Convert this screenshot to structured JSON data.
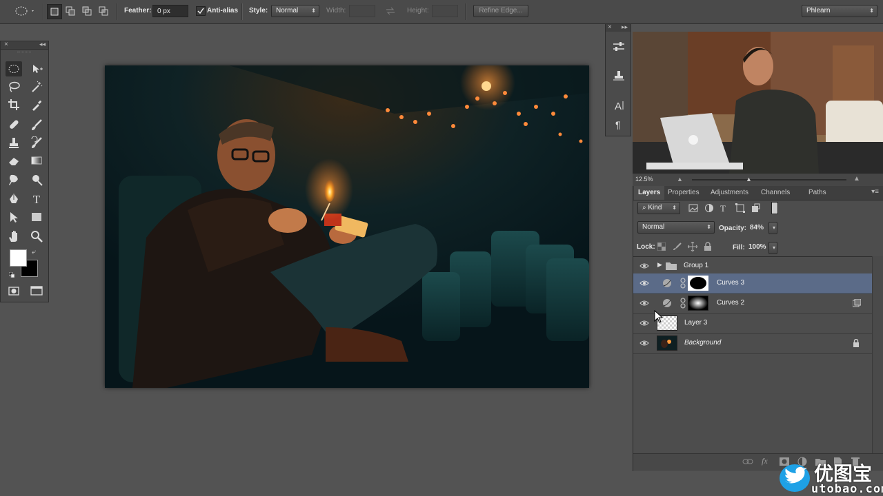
{
  "options_bar": {
    "feather_label": "Feather:",
    "feather_value": "0 px",
    "antialias_label": "Anti-alias",
    "style_label": "Style:",
    "style_value": "Normal",
    "width_label": "Width:",
    "height_label": "Height:",
    "refine_edge_label": "Refine Edge...",
    "workspace_value": "Phlearn"
  },
  "video": {
    "zoom": "12.5%"
  },
  "layers_panel": {
    "tabs": [
      {
        "label": "Layers",
        "active": true
      },
      {
        "label": "Properties",
        "active": false
      },
      {
        "label": "Adjustments",
        "active": false
      },
      {
        "label": "Channels",
        "active": false
      },
      {
        "label": "Paths",
        "active": false
      }
    ],
    "filter_label": "Kind",
    "blend_mode": "Normal",
    "opacity_label": "Opacity:",
    "opacity_value": "84%",
    "lock_label": "Lock:",
    "fill_label": "Fill:",
    "fill_value": "100%",
    "layers": [
      {
        "name": "Group 1",
        "type": "group",
        "selected": false
      },
      {
        "name": "Curves 3",
        "type": "adjustment",
        "selected": true
      },
      {
        "name": "Curves 2",
        "type": "adjustment",
        "selected": false
      },
      {
        "name": "Layer 3",
        "type": "pixel",
        "selected": false
      },
      {
        "name": "Background",
        "type": "background",
        "selected": false
      }
    ],
    "footer_icons": [
      "link-icon",
      "fx-icon",
      "mask-icon",
      "adjustment-icon",
      "folder-icon",
      "new-layer-icon",
      "trash-icon"
    ]
  },
  "tools": [
    "elliptical-marquee-icon",
    "move-icon",
    "lasso-icon",
    "magic-wand-icon",
    "crop-icon",
    "eyedropper-icon",
    "healing-brush-icon",
    "brush-icon",
    "clone-stamp-icon",
    "history-brush-icon",
    "eraser-icon",
    "gradient-icon",
    "smudge-icon",
    "dodge-icon",
    "pen-icon",
    "type-icon",
    "path-selection-icon",
    "rectangle-icon",
    "hand-icon",
    "zoom-icon"
  ],
  "colors": {
    "foreground": "#ffffff",
    "background": "#000000",
    "selection": "#5b6b88"
  },
  "watermark": {
    "brand": "优图宝",
    "url": "utobao.com"
  }
}
